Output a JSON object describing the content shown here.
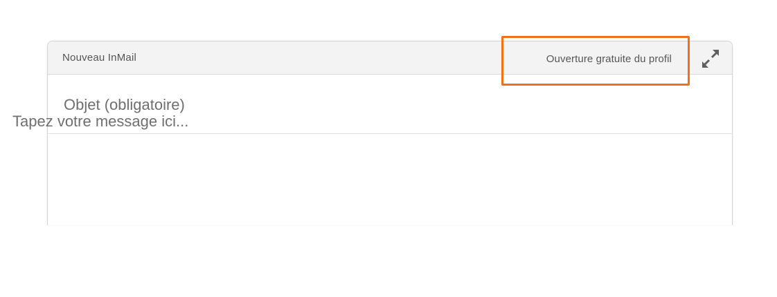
{
  "compose": {
    "title": "Nouveau InMail",
    "profile_open_label": "Ouverture gratuite du profil",
    "expand_icon": "expand-arrows-icon",
    "subject": {
      "value": "",
      "placeholder": "Objet (obligatoire)"
    },
    "message": {
      "value": "",
      "placeholder": "Tapez votre message ici..."
    }
  },
  "colors": {
    "highlight": "#ee7219",
    "header_bg": "#f3f3f3",
    "text": "#555555"
  }
}
